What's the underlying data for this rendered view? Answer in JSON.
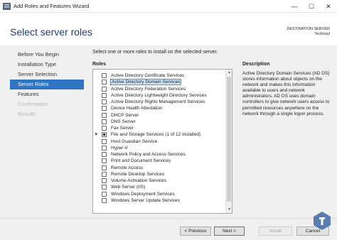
{
  "window": {
    "title": "Add Roles and Features Wizard",
    "controls": {
      "minimize": "—",
      "maximize": "☐",
      "close": "✕"
    }
  },
  "header": {
    "title": "Select server roles",
    "destination_label": "DESTINATION SERVER",
    "destination_value": "Technoyl"
  },
  "nav": {
    "items": [
      {
        "label": "Before You Begin",
        "state": "normal"
      },
      {
        "label": "Installation Type",
        "state": "normal"
      },
      {
        "label": "Server Selection",
        "state": "normal"
      },
      {
        "label": "Server Roles",
        "state": "active"
      },
      {
        "label": "Features",
        "state": "normal"
      },
      {
        "label": "Confirmation",
        "state": "disabled"
      },
      {
        "label": "Results",
        "state": "disabled"
      }
    ]
  },
  "main": {
    "instruction": "Select one or more roles to install on the selected server.",
    "roles_label": "Roles",
    "roles": [
      {
        "label": "Active Directory Certificate Services",
        "checked": false,
        "selected": false,
        "expandable": false
      },
      {
        "label": "Active Directory Domain Services",
        "checked": false,
        "selected": true,
        "expandable": false
      },
      {
        "label": "Active Directory Federation Services",
        "checked": false,
        "selected": false,
        "expandable": false
      },
      {
        "label": "Active Directory Lightweight Directory Services",
        "checked": false,
        "selected": false,
        "expandable": false
      },
      {
        "label": "Active Directory Rights Management Services",
        "checked": false,
        "selected": false,
        "expandable": false
      },
      {
        "label": "Device Health Attestation",
        "checked": false,
        "selected": false,
        "expandable": false
      },
      {
        "label": "DHCP Server",
        "checked": false,
        "selected": false,
        "expandable": false
      },
      {
        "label": "DNS Server",
        "checked": false,
        "selected": false,
        "expandable": false
      },
      {
        "label": "Fax Server",
        "checked": false,
        "selected": false,
        "expandable": false
      },
      {
        "label": "File and Storage Services (1 of 12 installed)",
        "checked": true,
        "selected": false,
        "expandable": true
      },
      {
        "label": "Host Guardian Service",
        "checked": false,
        "selected": false,
        "expandable": false
      },
      {
        "label": "Hyper-V",
        "checked": false,
        "selected": false,
        "expandable": false
      },
      {
        "label": "Network Policy and Access Services",
        "checked": false,
        "selected": false,
        "expandable": false
      },
      {
        "label": "Print and Document Services",
        "checked": false,
        "selected": false,
        "expandable": false
      },
      {
        "label": "Remote Access",
        "checked": false,
        "selected": false,
        "expandable": false
      },
      {
        "label": "Remote Desktop Services",
        "checked": false,
        "selected": false,
        "expandable": false
      },
      {
        "label": "Volume Activation Services",
        "checked": false,
        "selected": false,
        "expandable": false
      },
      {
        "label": "Web Server (IIS)",
        "checked": false,
        "selected": false,
        "expandable": false
      },
      {
        "label": "Windows Deployment Services",
        "checked": false,
        "selected": false,
        "expandable": false
      },
      {
        "label": "Windows Server Update Services",
        "checked": false,
        "selected": false,
        "expandable": false
      }
    ],
    "description_heading": "Description",
    "description_text": "Active Directory Domain Services (AD DS) stores information about objects on the network and makes this information available to users and network administrators. AD DS uses domain controllers to give network users access to permitted resources anywhere on the network through a single logon process."
  },
  "footer": {
    "previous": "< Previous",
    "next": "Next >",
    "install": "Install",
    "cancel": "Cancel"
  },
  "colors": {
    "accent": "#2f75c1",
    "title_blue": "#1d3f73",
    "selection": "#cce4f7"
  }
}
